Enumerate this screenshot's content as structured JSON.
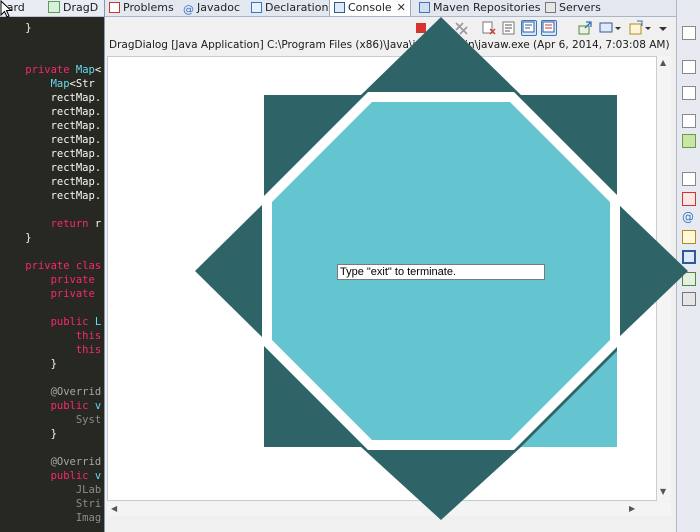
{
  "editor": {
    "tabs": [
      {
        "label": "oard"
      },
      {
        "label": "DragD"
      }
    ],
    "code_lines": [
      {
        "indent": "    ",
        "parts": [
          {
            "t": "}",
            "c": "c-pl"
          }
        ]
      },
      {
        "indent": "",
        "parts": []
      },
      {
        "indent": "",
        "parts": []
      },
      {
        "indent": "    ",
        "parts": [
          {
            "t": "private ",
            "c": "c-kw"
          },
          {
            "t": "Map",
            "c": "c-ty"
          },
          {
            "t": "<",
            "c": "c-pl"
          }
        ]
      },
      {
        "indent": "        ",
        "parts": [
          {
            "t": "Map",
            "c": "c-ty"
          },
          {
            "t": "<Str",
            "c": "c-pl"
          }
        ]
      },
      {
        "indent": "        ",
        "parts": [
          {
            "t": "rectMap.",
            "c": "c-pl"
          }
        ]
      },
      {
        "indent": "        ",
        "parts": [
          {
            "t": "rectMap.",
            "c": "c-pl"
          }
        ]
      },
      {
        "indent": "        ",
        "parts": [
          {
            "t": "rectMap.",
            "c": "c-pl"
          }
        ]
      },
      {
        "indent": "        ",
        "parts": [
          {
            "t": "rectMap.",
            "c": "c-pl"
          }
        ]
      },
      {
        "indent": "        ",
        "parts": [
          {
            "t": "rectMap.",
            "c": "c-pl"
          }
        ]
      },
      {
        "indent": "        ",
        "parts": [
          {
            "t": "rectMap.",
            "c": "c-pl"
          }
        ]
      },
      {
        "indent": "        ",
        "parts": [
          {
            "t": "rectMap.",
            "c": "c-pl"
          }
        ]
      },
      {
        "indent": "        ",
        "parts": [
          {
            "t": "rectMap.",
            "c": "c-pl"
          }
        ]
      },
      {
        "indent": "",
        "parts": []
      },
      {
        "indent": "        ",
        "parts": [
          {
            "t": "return ",
            "c": "c-kw"
          },
          {
            "t": "r",
            "c": "c-pl"
          }
        ]
      },
      {
        "indent": "    ",
        "parts": [
          {
            "t": "}",
            "c": "c-pl"
          }
        ]
      },
      {
        "indent": "",
        "parts": []
      },
      {
        "indent": "    ",
        "parts": [
          {
            "t": "private ",
            "c": "c-kw"
          },
          {
            "t": "clas",
            "c": "c-kw"
          }
        ]
      },
      {
        "indent": "        ",
        "parts": [
          {
            "t": "private",
            "c": "c-kw"
          }
        ]
      },
      {
        "indent": "        ",
        "parts": [
          {
            "t": "private",
            "c": "c-kw"
          }
        ]
      },
      {
        "indent": "",
        "parts": []
      },
      {
        "indent": "        ",
        "parts": [
          {
            "t": "public ",
            "c": "c-kw"
          },
          {
            "t": "L",
            "c": "c-ty"
          }
        ]
      },
      {
        "indent": "            ",
        "parts": [
          {
            "t": "this",
            "c": "c-kw"
          }
        ]
      },
      {
        "indent": "            ",
        "parts": [
          {
            "t": "this",
            "c": "c-kw"
          }
        ]
      },
      {
        "indent": "        ",
        "parts": [
          {
            "t": "}",
            "c": "c-pl"
          }
        ]
      },
      {
        "indent": "",
        "parts": []
      },
      {
        "indent": "        ",
        "parts": [
          {
            "t": "@Overrid",
            "c": "c-an"
          }
        ]
      },
      {
        "indent": "        ",
        "parts": [
          {
            "t": "public ",
            "c": "c-kw"
          },
          {
            "t": "v",
            "c": "c-ty"
          }
        ]
      },
      {
        "indent": "            ",
        "parts": [
          {
            "t": "Syst",
            "c": "c-gy"
          }
        ]
      },
      {
        "indent": "        ",
        "parts": [
          {
            "t": "}",
            "c": "c-pl"
          }
        ]
      },
      {
        "indent": "",
        "parts": []
      },
      {
        "indent": "        ",
        "parts": [
          {
            "t": "@Overrid",
            "c": "c-an"
          }
        ]
      },
      {
        "indent": "        ",
        "parts": [
          {
            "t": "public ",
            "c": "c-kw"
          },
          {
            "t": "v",
            "c": "c-ty"
          }
        ]
      },
      {
        "indent": "            ",
        "parts": [
          {
            "t": "JLab",
            "c": "c-gy"
          }
        ]
      },
      {
        "indent": "            ",
        "parts": [
          {
            "t": "Stri",
            "c": "c-gy"
          }
        ]
      },
      {
        "indent": "            ",
        "parts": [
          {
            "t": "Imag",
            "c": "c-gy"
          }
        ]
      }
    ]
  },
  "console_view": {
    "tabs": [
      {
        "label": "Problems",
        "icon": "problems-icon",
        "active": false
      },
      {
        "label": "Javadoc",
        "icon": "javadoc-icon",
        "active": false
      },
      {
        "label": "Declaration",
        "icon": "declaration-icon",
        "active": false
      },
      {
        "label": "Console",
        "icon": "console-icon",
        "active": true
      },
      {
        "label": "Maven Repositories",
        "icon": "maven-icon",
        "active": false
      },
      {
        "label": "Servers",
        "icon": "servers-icon",
        "active": false
      }
    ],
    "description": "DragDialog [Java Application] C:\\Program Files (x86)\\Java\\jdk1.6.0\\bin\\javaw.exe (Apr 6, 2014, 7:03:08 AM)",
    "toolbar_icons": [
      "terminate-icon",
      "remove-launch-icon",
      "remove-all-icon",
      "clear-console-icon",
      "scroll-lock-icon",
      "pin-console-icon",
      "word-wrap-icon",
      "open-console-icon",
      "display-console-icon",
      "view-menu-icon"
    ]
  },
  "dialog": {
    "input_value": "Type \"exit\" to terminate.",
    "colors": {
      "light": "#64c4d0",
      "dark": "#2e6468",
      "gap": "#ffffff"
    }
  },
  "colors": {
    "editor_bg": "#272822",
    "keyword": "#f92672",
    "type": "#66d9ef"
  }
}
